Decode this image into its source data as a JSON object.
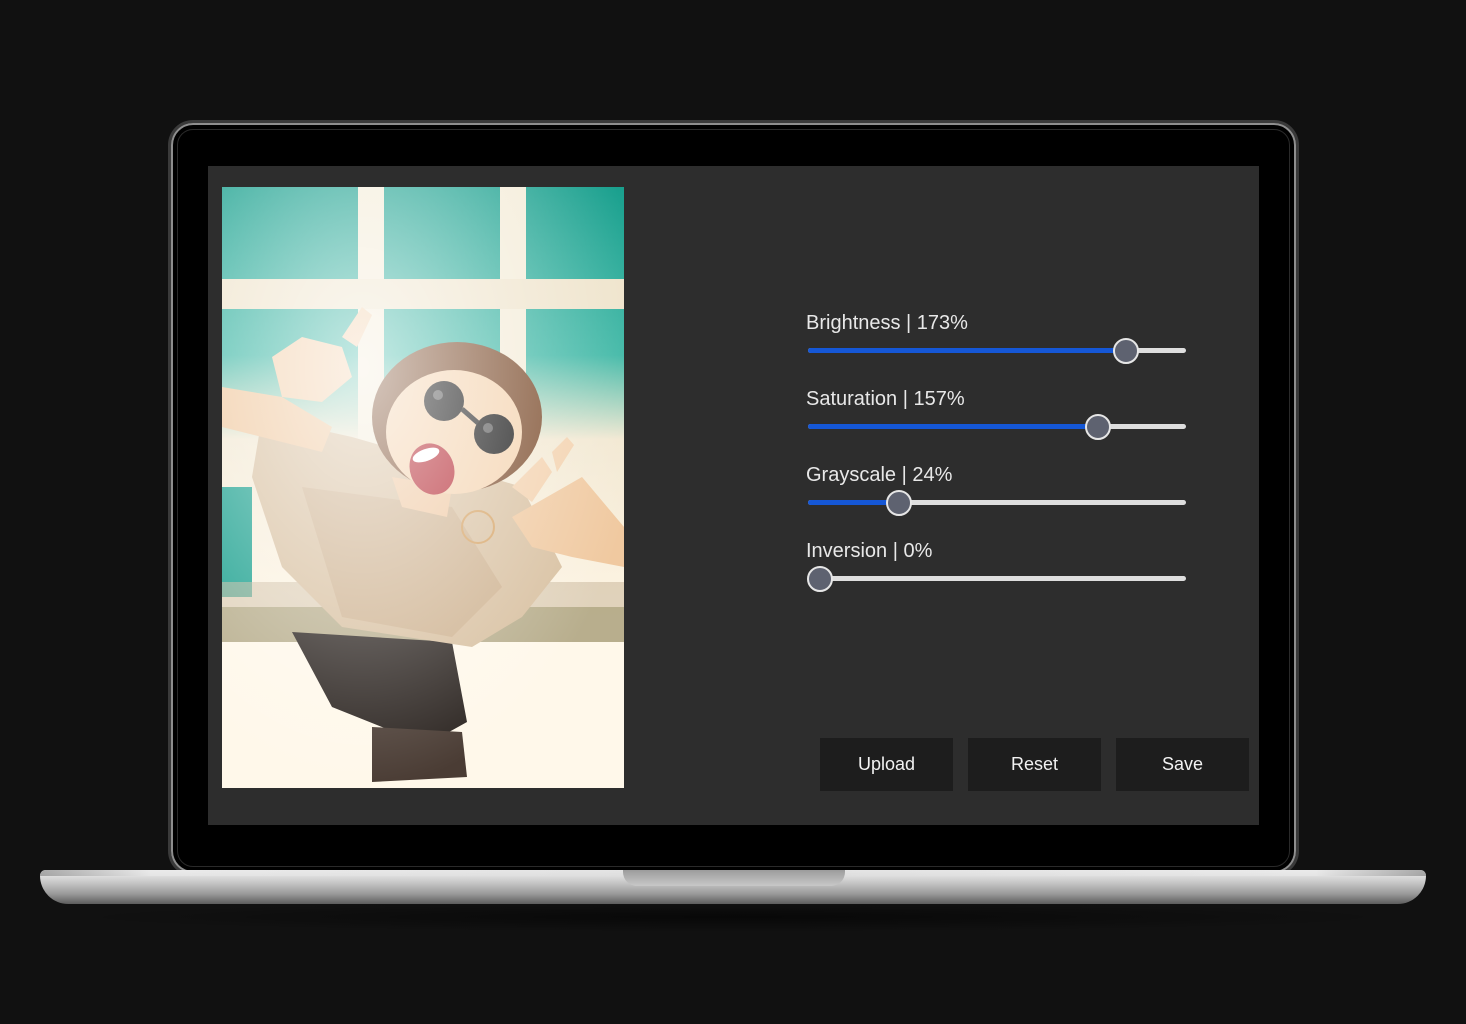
{
  "editor": {
    "sliders": [
      {
        "label": "Brightness | 173%",
        "level": 0.842
      },
      {
        "label": "Saturation | 157%",
        "level": 0.768
      },
      {
        "label": "Grayscale | 24%",
        "level": 0.24
      },
      {
        "label": "Inversion | 0%",
        "level": 0.0
      }
    ],
    "buttons": {
      "upload": "Upload",
      "reset": "Reset",
      "save": "Save"
    }
  },
  "colors": {
    "page_background": "#111111",
    "screen_background": "#2d2d2d",
    "slider_fill": "#1557d6",
    "slider_track": "#dedede",
    "slider_thumb": "#5e6270",
    "button_background": "#1d1d1d"
  }
}
